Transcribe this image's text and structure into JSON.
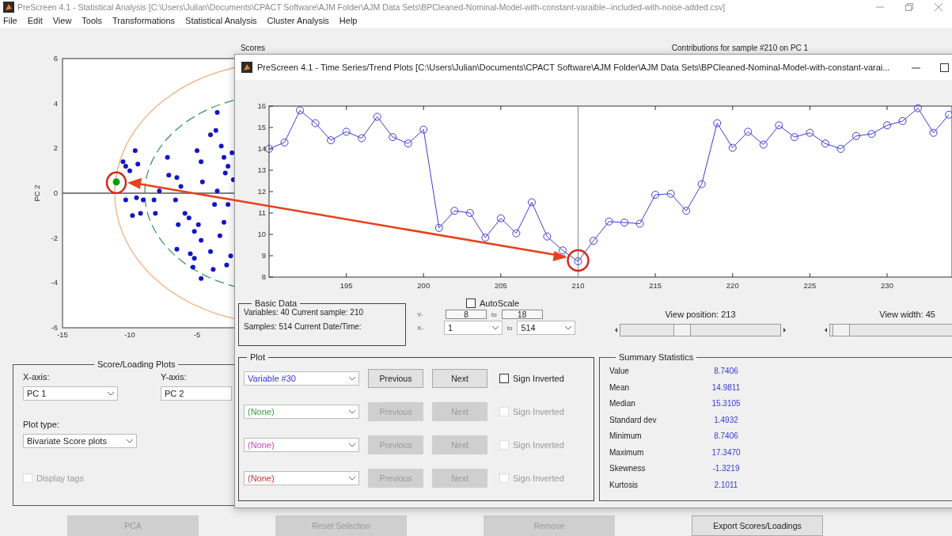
{
  "main_window": {
    "title": "PreScreen 4.1 - Statistical Analysis [C:\\Users\\Julian\\Documents\\CPACT Software\\AJM Folder\\AJM Data Sets\\BPCleaned-Nominal-Model-with-constant-varaible--included-with-noise-added.csv]"
  },
  "menu": [
    "File",
    "Edit",
    "View",
    "Tools",
    "Transformations",
    "Statistical Analysis",
    "Cluster Analysis",
    "Help"
  ],
  "scores_plot": {
    "chart_data": {
      "type": "scatter",
      "title": "Scores",
      "ylabel": "PC 2",
      "xlim": [
        -15,
        -2
      ],
      "ylim": [
        -6,
        6
      ],
      "xticks": [
        -15,
        -10,
        -5
      ],
      "yticks": [
        -6,
        -4,
        -2,
        0,
        2,
        4,
        6
      ],
      "x": [
        -10.5,
        -10.3,
        -10.0,
        -9.6,
        -9.4,
        -10.3,
        -9.8,
        -9.2,
        -9.5,
        -9.0,
        -8.2,
        -8.1,
        -7.8,
        -7.2,
        -7.1,
        -6.5,
        -6.2,
        -6.6,
        -6.4,
        -5.9,
        -5.6,
        -5.2,
        -4.9,
        -5.0,
        -4.7,
        -4.0,
        -3.6,
        -3.5,
        -3.2,
        -3.0,
        -2.7,
        -2.9,
        -3.5,
        -4.6,
        -3.7,
        -2.7,
        -3.0,
        -3.3,
        -4.7,
        -5.5,
        -6.5,
        -5.3,
        -4.7,
        -3.8,
        -2.8,
        -2.5,
        -4.0,
        -5.2,
        -2.4,
        -2.3,
        -11
      ],
      "series": [
        {
          "color": "#1414c8",
          "values": [
            1.4,
            1.2,
            1.0,
            1.9,
            1.3,
            -0.3,
            -1.0,
            -0.9,
            -0.2,
            -0.3,
            -0.3,
            -0.9,
            0.1,
            1.6,
            0.8,
            0.7,
            0.3,
            -0.3,
            -1.4,
            -0.9,
            -1.1,
            -1.7,
            -1.4,
            1.9,
            1.4,
            2.6,
            2.8,
            3.6,
            2.1,
            1.6,
            1.2,
            0.9,
            0.1,
            0.5,
            -0.5,
            -0.5,
            -1.3,
            -1.9,
            -2.1,
            -2.7,
            -2.5,
            -3.3,
            -3.8,
            -3.4,
            -3.2,
            -2.8,
            -2.6,
            -2.9,
            1.8,
            0.6,
            null
          ]
        },
        {
          "color": "#00a000",
          "values": [
            null,
            null,
            null,
            null,
            null,
            null,
            null,
            null,
            null,
            null,
            null,
            null,
            null,
            null,
            null,
            null,
            null,
            null,
            null,
            null,
            null,
            null,
            null,
            null,
            null,
            null,
            null,
            null,
            null,
            null,
            null,
            null,
            null,
            null,
            null,
            null,
            null,
            null,
            null,
            null,
            null,
            null,
            null,
            null,
            null,
            null,
            null,
            null,
            null,
            null,
            0.5
          ]
        }
      ]
    },
    "contributions_title": "Contributions for sample #210 on PC 1"
  },
  "score_loading_plots": {
    "title": "Score/Loading Plots",
    "x_axis": {
      "label": "X-axis:",
      "value": "PC 1"
    },
    "y_axis": {
      "label": "Y-axis:",
      "value": "PC 2"
    },
    "plot_type": {
      "label": "Plot type:",
      "value": "Bivariate Score plots"
    },
    "display_tags": {
      "label": "Display tags",
      "checked": false,
      "disabled": true
    }
  },
  "buttons": [
    {
      "label": "PCA",
      "disabled": true
    },
    {
      "label": "Reset Selection",
      "disabled": true
    },
    {
      "label": "Remove",
      "disabled": true
    },
    {
      "label": "Export Scores/Loadings",
      "disabled": false
    }
  ],
  "trend_window": {
    "title": "PreScreen 4.1 - Time Series/Trend Plots [C:\\Users\\Julian\\Documents\\CPACT Software\\AJM Folder\\AJM Data Sets\\BPCleaned-Nominal-Model-with-constant-varai...",
    "chart_data": {
      "type": "line",
      "xlim": [
        190,
        234.2
      ],
      "ylim": [
        8,
        16
      ],
      "xticks": [
        195,
        200,
        205,
        210,
        215,
        220,
        225,
        230
      ],
      "yticks": [
        8,
        9,
        10,
        11,
        12,
        13,
        14,
        15,
        16
      ],
      "x": [
        190,
        191,
        192,
        193,
        194,
        195,
        196,
        197,
        198,
        199,
        200,
        201,
        202,
        203,
        204,
        205,
        206,
        207,
        208,
        209,
        210,
        211,
        212,
        213,
        214,
        215,
        216,
        217,
        218,
        219,
        220,
        221,
        222,
        223,
        224,
        225,
        226,
        227,
        228,
        229,
        230,
        231,
        232,
        233,
        234
      ],
      "series": [
        {
          "color": "#3c3cd2",
          "marker": "o",
          "values": [
            14.0,
            14.3,
            15.8,
            15.2,
            14.4,
            14.8,
            14.5,
            15.5,
            14.55,
            14.25,
            14.9,
            10.3,
            11.1,
            11.0,
            9.85,
            10.75,
            10.05,
            11.5,
            9.9,
            9.25,
            8.74,
            9.7,
            10.6,
            10.55,
            10.5,
            11.85,
            11.9,
            11.1,
            12.35,
            15.2,
            14.05,
            14.8,
            14.2,
            15.1,
            14.55,
            14.75,
            14.25,
            14.0,
            14.6,
            14.7,
            15.1,
            15.3,
            15.9,
            14.75,
            15.6
          ]
        }
      ],
      "ref_lines": [
        {
          "axis": "x",
          "value": 210
        }
      ]
    },
    "basic_data": {
      "title": "Basic Data",
      "lines": [
        "Variables: 40 Current sample: 210",
        "Samples: 514 Current Date/Time:"
      ]
    },
    "autoscale": {
      "label": "AutoScale",
      "checked": false
    },
    "y_range": {
      "label": "Y-",
      "from": "8",
      "to_label": "to",
      "to": "18"
    },
    "x_range": {
      "label": "X-",
      "from": "1",
      "to_label": "to",
      "to": "514"
    },
    "view_position": {
      "label": "View position: 213",
      "level": 0.38
    },
    "view_width": {
      "label": "View width: 45",
      "level": 0.08
    },
    "plot": {
      "title": "Plot",
      "rows": [
        {
          "variable": "Variable #30",
          "color": "#3333cc",
          "previous": "Previous",
          "next": "Next",
          "sign_label": "Sign Inverted",
          "checked": false,
          "disabled": false
        },
        {
          "variable": "(None)",
          "color": "#3aa03a",
          "previous": "Previous",
          "next": "Next",
          "sign_label": "Sign Inverted",
          "checked": false,
          "disabled": true
        },
        {
          "variable": "(None)",
          "color": "#d040d0",
          "previous": "Previous",
          "next": "Next",
          "sign_label": "Sign Inverted",
          "checked": false,
          "disabled": true
        },
        {
          "variable": "(None)",
          "color": "#d03030",
          "previous": "Previous",
          "next": "Next",
          "sign_label": "Sign Inverted",
          "checked": false,
          "disabled": true
        }
      ]
    },
    "summary": {
      "title": "Summary Statistics",
      "rows": [
        {
          "label": "Value",
          "value": "8.7406"
        },
        {
          "label": "Mean",
          "value": "14.9811"
        },
        {
          "label": "Median",
          "value": "15.3105"
        },
        {
          "label": "Standard dev",
          "value": "1.4932"
        },
        {
          "label": "Minimum",
          "value": "8.7406"
        },
        {
          "label": "Maximum",
          "value": "17.3470"
        },
        {
          "label": "Skewness",
          "value": "-1.3219"
        },
        {
          "label": "Kurtosis",
          "value": "2.1011"
        }
      ]
    }
  }
}
